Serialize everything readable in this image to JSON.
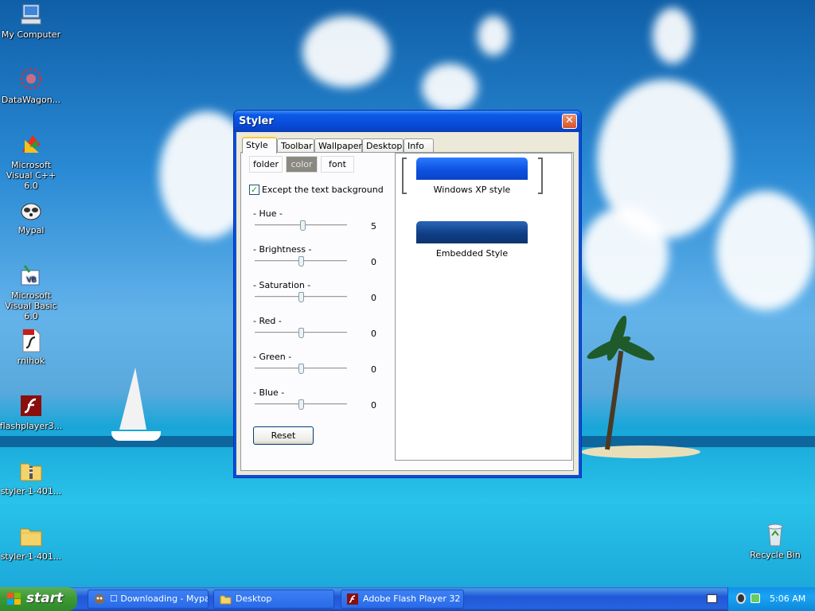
{
  "desktop": {
    "icons": [
      {
        "label": "My Computer",
        "icon": "my-computer-icon"
      },
      {
        "label": "DataWagon...",
        "icon": "datawagon-icon"
      },
      {
        "label": "Microsoft Visual C++ 6.0",
        "icon": "visual-cpp-icon"
      },
      {
        "label": "Mypal",
        "icon": "mypal-icon"
      },
      {
        "label": "Microsoft Visual Basic 6.0",
        "icon": "visual-basic-icon"
      },
      {
        "label": "rnihok",
        "icon": "swf-file-icon"
      },
      {
        "label": "flashplayer3...",
        "icon": "flash-player-icon"
      },
      {
        "label": "styler-1-401...",
        "icon": "zip-folder-icon"
      },
      {
        "label": "styler-1-401...",
        "icon": "folder-icon"
      }
    ],
    "recycle_bin": {
      "label": "Recycle Bin",
      "icon": "recycle-bin-icon"
    }
  },
  "window": {
    "title": "Styler",
    "close_glyph": "✕",
    "tabs": [
      "Style",
      "Toolbar",
      "Wallpaper",
      "Desktop",
      "Info"
    ],
    "active_tab": "Style",
    "subtabs": [
      "folder",
      "color",
      "font"
    ],
    "selected_subtab": "color",
    "checkbox": {
      "label": "Except the text background",
      "checked": true,
      "mark": "✓"
    },
    "sliders": [
      {
        "label": "- Hue -",
        "value": "5",
        "level": 0.52
      },
      {
        "label": "- Brightness -",
        "value": "0",
        "level": 0.5
      },
      {
        "label": "- Saturation -",
        "value": "0",
        "level": 0.5
      },
      {
        "label": "- Red -",
        "value": "0",
        "level": 0.5
      },
      {
        "label": "- Green -",
        "value": "0",
        "level": 0.5
      },
      {
        "label": "- Blue -",
        "value": "0",
        "level": 0.5
      }
    ],
    "reset_label": "Reset",
    "styles": [
      {
        "label": "Windows XP style",
        "color": "#0d52e0",
        "selected": true
      },
      {
        "label": "Embedded Style",
        "color": "#0f3f86",
        "selected": false
      }
    ]
  },
  "taskbar": {
    "start_label": "start",
    "tasks": [
      {
        "label": "☐ Downloading - Mypal",
        "icon": "mypal-icon"
      },
      {
        "label": "Desktop",
        "icon": "folder-icon"
      },
      {
        "label": "Adobe Flash Player 32",
        "icon": "flash-player-icon"
      }
    ],
    "clock": "5:06 AM"
  },
  "colors": {
    "title_bar": "#0a5ae8",
    "close_button": "#d8532b",
    "taskbar": "#2157d7",
    "start_button": "#3c9a34",
    "window_face": "#ece9d8"
  }
}
